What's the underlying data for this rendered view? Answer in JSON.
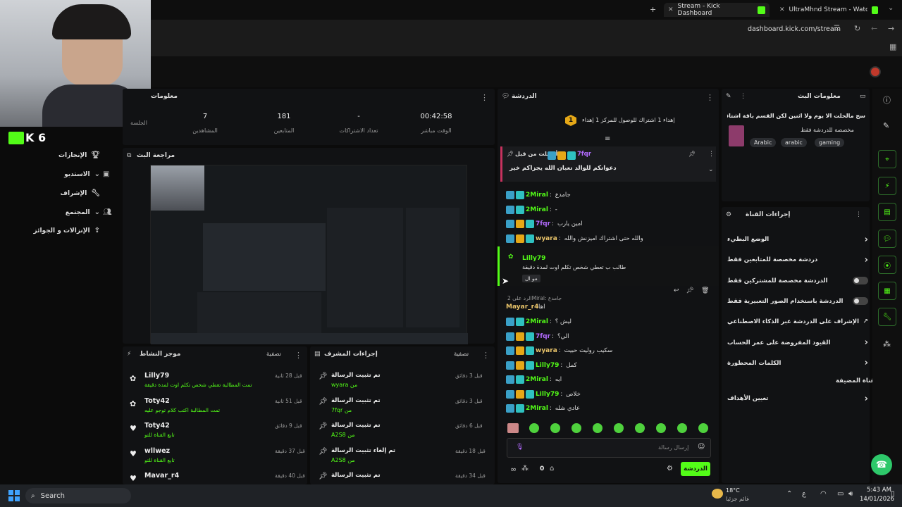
{
  "browser": {
    "tabs": [
      {
        "label": "Stream - Kick Dashboard"
      },
      {
        "label": "UltraMhnd Stream - Watch Live"
      }
    ],
    "url": "dashboard.kick.com/stream",
    "new_tab_label": "+"
  },
  "stream_info_panel": {
    "title": "معلومات",
    "stats": [
      {
        "value": "",
        "label": "الجلسة"
      },
      {
        "value": "7",
        "label": "المشاهدين"
      },
      {
        "value": "181",
        "label": "المتابعين"
      },
      {
        "value": "-",
        "label": "تعداد الاشتراكات"
      },
      {
        "value": "00:42:58",
        "label": "الوقت مباشر"
      }
    ]
  },
  "sidebar": {
    "brand": "K 6",
    "items": [
      {
        "label": "الإنجازات",
        "icon": "trophy-icon"
      },
      {
        "label": "الاستديو",
        "icon": "chevron-down-icon"
      },
      {
        "label": "الإشراف",
        "icon": "wrench-icon"
      },
      {
        "label": "المجتمع",
        "icon": "chevron-down-icon"
      },
      {
        "label": "الإنزالات و الجوائز",
        "icon": "gift-icon"
      }
    ]
  },
  "preview_panel": {
    "title": "مراجعة البث"
  },
  "activity_panel": {
    "title": "موجز النشاط",
    "filter_label": "تصفية",
    "items": [
      {
        "user": "Lilly79",
        "action": "تمت المطالبة تعطي شخص تكلم اوت لمدة دقيقة",
        "time": "قبل 28 ثانية",
        "icon": "reward-icon"
      },
      {
        "user": "Toty42",
        "action": "تمت المطالبة اكتب كلام توجو عليه",
        "time": "قبل 51 ثانية",
        "icon": "reward-icon"
      },
      {
        "user": "Toty42",
        "action": "تابع القناة للتو",
        "time": "قبل 9 دقائق",
        "icon": "heart-icon"
      },
      {
        "user": "wllwez",
        "action": "تابع القناة للتو",
        "time": "قبل 37 دقيقة",
        "icon": "heart-icon"
      },
      {
        "user": "Mavar_r4",
        "action": "",
        "time": "قبل 40 دقيقة",
        "icon": "heart-icon"
      }
    ]
  },
  "mod_actions_panel": {
    "title": "إجراءات المشرف",
    "filter_label": "تصفية",
    "items": [
      {
        "action": "تم تثبيت الرسالة",
        "by": "من wyara",
        "time": "قبل 3 دقائق"
      },
      {
        "action": "تم تثبيت الرسالة",
        "by": "من 7fqr",
        "time": "قبل 3 دقائق"
      },
      {
        "action": "تم تثبيت الرسالة",
        "by": "من A2S8",
        "time": "قبل 6 دقائق"
      },
      {
        "action": "تم إلغاء تثبيت الرسالة",
        "by": "من A2S8",
        "time": "قبل 18 دقيقة"
      },
      {
        "action": "تم تثبيت الرسالة",
        "by": "",
        "time": "قبل 34 دقيقة"
      }
    ]
  },
  "chat_panel": {
    "title": "الدردشة",
    "goal_text": "إهداء 1 اشتراك للوصول للمركز 1 إهداء",
    "goal_number": "1",
    "pinned": {
      "header": "أرسلت من قبل",
      "user": "7fqr",
      "message": "دعواتكم للوالد تعبان الله يجزاكم خير"
    },
    "messages": [
      {
        "user": "2Miral",
        "text": "جامدع",
        "color": "#53fc18"
      },
      {
        "user": "2Miral",
        "text": "-",
        "color": "#53fc18"
      },
      {
        "user": "7fqr",
        "text": "امين يارب",
        "color": "#b36bff"
      },
      {
        "user": "wyara",
        "text": "والله حتى اشتراك اميزنش والله",
        "color": "#e9c46a"
      }
    ],
    "highlight": {
      "user": "Lilly79",
      "text": "طالب ب تعطي شخص تكلم اوت لمدة دقيقة",
      "tag": "مو ال"
    },
    "reply": {
      "ref": "الرد على 2Miral: جامدع",
      "user": "Mayar_r4",
      "text": "اها"
    },
    "messages2": [
      {
        "user": "2Miral",
        "text": "ليش ؟",
        "color": "#53fc18"
      },
      {
        "user": "7fqr",
        "text": "الي؟",
        "color": "#b36bff"
      },
      {
        "user": "wyara",
        "text": "سكيب روليت حبيت",
        "color": "#e9c46a"
      },
      {
        "user": "Lilly79",
        "text": "كمل",
        "color": "#53fc18"
      },
      {
        "user": "2Miral",
        "text": "ايه",
        "color": "#53fc18"
      },
      {
        "user": "Lilly79",
        "text": "خلاص",
        "color": "#53fc18"
      },
      {
        "user": "2Miral",
        "text": "عادي شله",
        "color": "#53fc18"
      }
    ],
    "input_placeholder": "إرسال رسالة",
    "points": "0",
    "send_label": "الدردشة"
  },
  "stream_info_right": {
    "title": "معلومات البث",
    "stream_title": "سح مالحلت الا يوم ولا اثنين لكن القسم باقة اشتاقت البثوث",
    "category": "مخصصة للدردشة فقط",
    "tags": [
      "Arabic",
      "arabic",
      "gaming"
    ]
  },
  "channel_actions": {
    "title": "إجراءات القناة",
    "rows": [
      {
        "label": "الوضع البطيء",
        "control": "chevron"
      },
      {
        "label": "دردشة مخصصة للمتابعين فقط",
        "control": "chevron"
      },
      {
        "label": "الدردشة مخصصة للمشتركين فقط",
        "control": "toggle"
      },
      {
        "label": "الدردشة باستخدام الصور التعبيرية فقط",
        "control": "toggle"
      },
      {
        "label": "الإشراف على الدردشة عبر الذكاء الاصطناعي",
        "control": "external"
      },
      {
        "label": "القيود المفروضة على عمر الحساب",
        "control": "chevron"
      },
      {
        "label": "الكلمات المحظورة",
        "control": "chevron"
      }
    ],
    "section_label": "القناة المضيفة",
    "host_row": "تعيين الأهداف"
  },
  "taskbar": {
    "search": "Search",
    "weather_temp": "18°C",
    "weather_desc": "غائم جزئيا",
    "time": "5:43 AM",
    "date": "14/01/2026"
  },
  "colors": {
    "accent": "#53fc18",
    "bg": "#0b0b0b",
    "panel": "#111214"
  }
}
